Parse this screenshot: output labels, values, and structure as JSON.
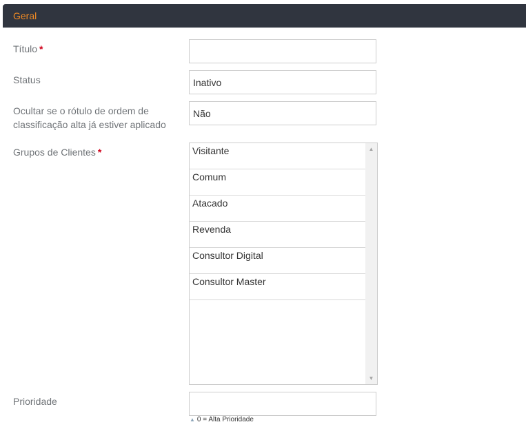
{
  "section": {
    "title": "Geral"
  },
  "fields": {
    "titulo": {
      "label": "Título",
      "required_mark": "*",
      "value": ""
    },
    "status": {
      "label": "Status",
      "value": "Inativo"
    },
    "ocultar": {
      "label": "Ocultar se o rótulo de ordem de classificação alta já estiver aplicado",
      "value": "Não"
    },
    "grupos": {
      "label": "Grupos de Clientes",
      "required_mark": "*",
      "options": [
        "Visitante",
        "Comum",
        "Atacado",
        "Revenda",
        "Consultor Digital",
        "Consultor Master"
      ]
    },
    "prioridade": {
      "label": "Prioridade",
      "value": "",
      "help": "0 = Alta Prioridade",
      "help_icon": "triangle-up-icon"
    }
  },
  "colors": {
    "header_bg": "#30353f",
    "header_text": "#f08a24",
    "required": "#d0021b",
    "label": "#707478"
  }
}
